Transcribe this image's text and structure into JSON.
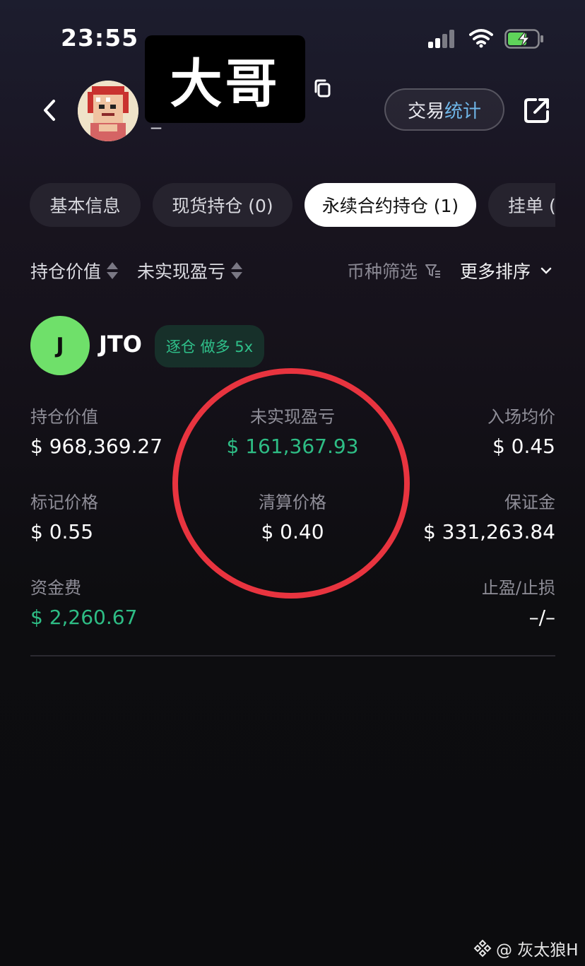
{
  "status_bar": {
    "time": "23:55"
  },
  "header": {
    "nickname": "大哥",
    "nickname_suffix": "_",
    "stats_button": {
      "part1": "交易",
      "part2": "统计"
    },
    "icons": [
      "chevron-left-icon",
      "copy-icon",
      "share-external-icon"
    ]
  },
  "tabs": [
    {
      "label": "基本信息",
      "active": false
    },
    {
      "label": "现货持仓 (0)",
      "active": false
    },
    {
      "label": "永续合约持仓 (1)",
      "active": true
    },
    {
      "label": "挂单 (",
      "active": false
    }
  ],
  "sort_bar": {
    "position_value": "持仓价值",
    "unrealized_pnl": "未实现盈亏",
    "coin_filter": "币种筛选",
    "more_sort": "更多排序"
  },
  "position": {
    "coin_letter": "J",
    "coin": "JTO",
    "badge": "逐仓 做多 5x",
    "fields": {
      "position_value": {
        "label": "持仓价值",
        "value": "$ 968,369.27"
      },
      "unrealized_pnl": {
        "label": "未实现盈亏",
        "value": "$ 161,367.93"
      },
      "entry_price": {
        "label": "入场均价",
        "value": "$ 0.45"
      },
      "mark_price": {
        "label": "标记价格",
        "value": "$ 0.55"
      },
      "liq_price": {
        "label": "清算价格",
        "value": "$ 0.40"
      },
      "margin": {
        "label": "保证金",
        "value": "$ 331,263.84"
      },
      "funding_fee": {
        "label": "资金费",
        "value": "$ 2,260.67"
      },
      "tp_sl": {
        "label": "止盈/止损",
        "value": "–/–"
      }
    }
  },
  "watermark": {
    "text": "@ 灰太狼H"
  },
  "colors": {
    "green": "#2ebd85",
    "highlight_circle": "#e8343f",
    "coin_avatar": "#6fe06a"
  }
}
